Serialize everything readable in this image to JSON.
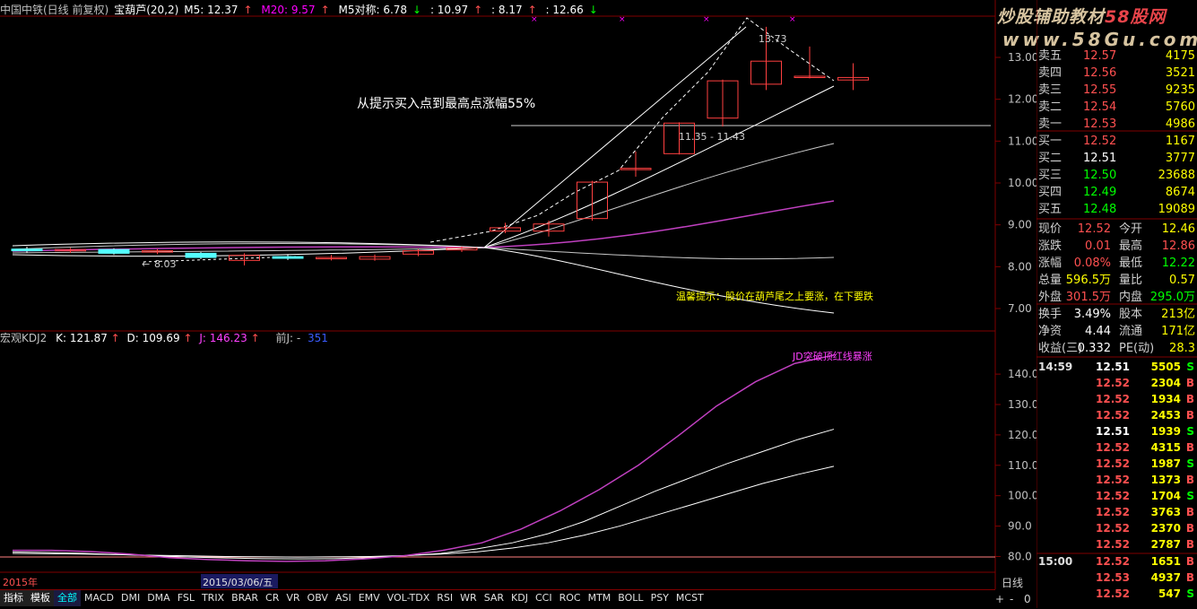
{
  "main_info": {
    "stock": "中国中铁(日线 前复权)",
    "indicator": "宝葫芦(20,2)",
    "m5": "M5: 12.37",
    "m20": "M20: 9.57",
    "m5_dui": "M5对称: 6.78",
    "v1": ": 10.97",
    "v2": ": 8.17",
    "v3": ": 12.66"
  },
  "price_axis": [
    "13.00",
    "12.00",
    "11.00",
    "10.00",
    "9.00",
    "8.00",
    "7.00"
  ],
  "annotations": {
    "gain_text": "从提示买入点到最高点涨幅55%",
    "high_label": "13.73",
    "range_label": "11.35 - 11.43",
    "low_label": "8.03",
    "tip_text": "温馨提示：股价在葫芦尾之上要涨，在下要跌"
  },
  "kdj_info": {
    "name": "宏观KDJ2",
    "k": "K: 121.87",
    "d": "D: 109.69",
    "j": "J: 146.23",
    "prev": "前J: -",
    "prev_val": "351"
  },
  "kdj_axis": [
    "140.0",
    "130.0",
    "120.0",
    "110.0",
    "100.0",
    "90.0",
    "80.0"
  ],
  "kdj_note": "JD突破顶红线暴涨",
  "x_labels": {
    "year": "2015年",
    "date": "2015/03/06/五"
  },
  "period_label": "日线",
  "zoom_controls": [
    "+",
    "-",
    "0"
  ],
  "watermark": {
    "line1": "炒股辅助教材",
    "line1_red": "58股网",
    "line2": "www.58Gu.com"
  },
  "order_book": {
    "sells": [
      {
        "label": "卖五",
        "price": "12.57",
        "vol": "4175"
      },
      {
        "label": "卖四",
        "price": "12.56",
        "vol": "3521"
      },
      {
        "label": "卖三",
        "price": "12.55",
        "vol": "9235"
      },
      {
        "label": "卖二",
        "price": "12.54",
        "vol": "5760"
      },
      {
        "label": "卖一",
        "price": "12.53",
        "vol": "4986"
      }
    ],
    "buys": [
      {
        "label": "买一",
        "price": "12.52",
        "vol": "1167"
      },
      {
        "label": "买二",
        "price": "12.51",
        "vol": "3777"
      },
      {
        "label": "买三",
        "price": "12.50",
        "vol": "23688"
      },
      {
        "label": "买四",
        "price": "12.49",
        "vol": "8674"
      },
      {
        "label": "买五",
        "price": "12.48",
        "vol": "19089"
      }
    ]
  },
  "quote": [
    {
      "l1": "现价",
      "v1": "12.52",
      "l2": "今开",
      "v2": "12.46"
    },
    {
      "l1": "涨跌",
      "v1": "0.01",
      "l2": "最高",
      "v2": "12.86"
    },
    {
      "l1": "涨幅",
      "v1": "0.08%",
      "l2": "最低",
      "v2": "12.22"
    },
    {
      "l1": "总量",
      "v1": "596.5万",
      "l2": "量比",
      "v2": "0.57"
    },
    {
      "l1": "外盘",
      "v1": "301.5万",
      "l2": "内盘",
      "v2": "295.0万"
    },
    {
      "l1": "换手",
      "v1": "3.49%",
      "l2": "股本",
      "v2": "213亿"
    },
    {
      "l1": "净资",
      "v1": "4.44",
      "l2": "流通",
      "v2": "171亿"
    },
    {
      "l1": "收益(三)",
      "v1": "0.332",
      "l2": "PE(动)",
      "v2": "28.3"
    }
  ],
  "ticks": [
    {
      "t": "14:59",
      "p": "12.51",
      "v": "5505",
      "d": "S"
    },
    {
      "t": "",
      "p": "12.52",
      "v": "2304",
      "d": "B"
    },
    {
      "t": "",
      "p": "12.52",
      "v": "1934",
      "d": "B"
    },
    {
      "t": "",
      "p": "12.52",
      "v": "2453",
      "d": "B"
    },
    {
      "t": "",
      "p": "12.51",
      "v": "1939",
      "d": "S"
    },
    {
      "t": "",
      "p": "12.52",
      "v": "4315",
      "d": "B"
    },
    {
      "t": "",
      "p": "12.52",
      "v": "1987",
      "d": "S"
    },
    {
      "t": "",
      "p": "12.52",
      "v": "1373",
      "d": "B"
    },
    {
      "t": "",
      "p": "12.52",
      "v": "1704",
      "d": "S"
    },
    {
      "t": "",
      "p": "12.52",
      "v": "3763",
      "d": "B"
    },
    {
      "t": "",
      "p": "12.52",
      "v": "2370",
      "d": "B"
    },
    {
      "t": "",
      "p": "12.52",
      "v": "2787",
      "d": "B"
    },
    {
      "t": "15:00",
      "p": "12.52",
      "v": "1651",
      "d": "B"
    },
    {
      "t": "",
      "p": "12.53",
      "v": "4937",
      "d": "B"
    },
    {
      "t": "",
      "p": "12.52",
      "v": "547",
      "d": "S"
    }
  ],
  "bottom_tabs": [
    "指标",
    "模板",
    "全部",
    "MACD",
    "DMI",
    "DMA",
    "FSL",
    "TRIX",
    "BRAR",
    "CR",
    "VR",
    "OBV",
    "ASI",
    "EMV",
    "VOL-TDX",
    "RSI",
    "WR",
    "SAR",
    "KDJ",
    "CCI",
    "ROC",
    "MTM",
    "BOLL",
    "PSY",
    "MCST"
  ],
  "chart_data": {
    "type": "candlestick",
    "ylim": [
      6.7,
      13.9
    ],
    "candles": [
      {
        "o": 8.42,
        "c": 8.38,
        "h": 8.48,
        "l": 8.33
      },
      {
        "o": 8.39,
        "c": 8.41,
        "h": 8.45,
        "l": 8.33
      },
      {
        "o": 8.41,
        "c": 8.32,
        "h": 8.44,
        "l": 8.28
      },
      {
        "o": 8.35,
        "c": 8.38,
        "h": 8.42,
        "l": 8.3
      },
      {
        "o": 8.32,
        "c": 8.22,
        "h": 8.35,
        "l": 8.18
      },
      {
        "o": 8.15,
        "c": 8.27,
        "h": 8.32,
        "l": 8.03
      },
      {
        "o": 8.24,
        "c": 8.2,
        "h": 8.3,
        "l": 8.16
      },
      {
        "o": 8.2,
        "c": 8.22,
        "h": 8.28,
        "l": 8.15
      },
      {
        "o": 8.18,
        "c": 8.24,
        "h": 8.29,
        "l": 8.14
      },
      {
        "o": 8.3,
        "c": 8.38,
        "h": 8.42,
        "l": 8.25
      },
      {
        "o": 8.4,
        "c": 8.45,
        "h": 8.48,
        "l": 8.35
      },
      {
        "o": 8.85,
        "c": 8.93,
        "h": 9.05,
        "l": 8.8
      },
      {
        "o": 8.85,
        "c": 9.02,
        "h": 9.1,
        "l": 8.72
      },
      {
        "o": 9.15,
        "c": 10.02,
        "h": 10.05,
        "l": 9.1
      },
      {
        "o": 10.35,
        "c": 10.35,
        "h": 10.75,
        "l": 10.15
      },
      {
        "o": 10.7,
        "c": 11.43,
        "h": 11.45,
        "l": 10.68
      },
      {
        "o": 11.55,
        "c": 12.44,
        "h": 12.47,
        "l": 11.35
      },
      {
        "o": 12.36,
        "c": 12.91,
        "h": 13.73,
        "l": 12.22
      },
      {
        "o": 12.53,
        "c": 12.55,
        "h": 13.26,
        "l": 12.5
      },
      {
        "o": 12.46,
        "c": 12.52,
        "h": 12.86,
        "l": 12.22
      }
    ],
    "kdj": {
      "ylim": [
        76,
        148
      ],
      "K": [
        81.5,
        81.3,
        81.0,
        80.6,
        80.2,
        79.8,
        79.5,
        79.3,
        79.2,
        79.3,
        79.6,
        80.2,
        81.0,
        82.5,
        84.5,
        87.5,
        91.5,
        96.5,
        101.5,
        106.0,
        110.5,
        114.5,
        118.5,
        121.87
      ],
      "D": [
        81.0,
        80.9,
        80.8,
        80.6,
        80.4,
        80.2,
        80.0,
        79.9,
        79.8,
        79.9,
        80.0,
        80.3,
        80.8,
        81.5,
        82.8,
        84.5,
        87.0,
        90.0,
        93.5,
        97.0,
        100.5,
        104.0,
        107.0,
        109.69
      ],
      "J": [
        82.0,
        82.0,
        81.6,
        80.8,
        79.6,
        79.0,
        78.6,
        78.4,
        78.6,
        79.2,
        80.2,
        82.0,
        84.5,
        89.0,
        95.0,
        102.0,
        110.0,
        119.5,
        129.5,
        137.5,
        143.5,
        146.23
      ]
    }
  }
}
